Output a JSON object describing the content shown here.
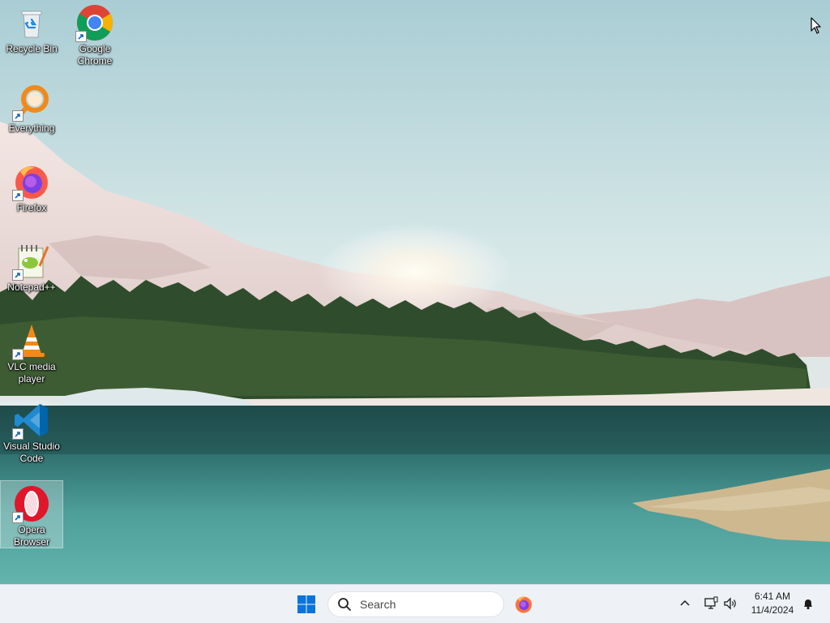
{
  "desktop": {
    "icons": [
      {
        "name": "recycle-bin",
        "label": "Recycle Bin",
        "icon": "recycle-bin-icon",
        "shortcut": false
      },
      {
        "name": "google-chrome",
        "label": "Google Chrome",
        "icon": "chrome-icon",
        "shortcut": true
      },
      {
        "name": "everything",
        "label": "Everything",
        "icon": "everything-search-icon",
        "shortcut": true
      },
      {
        "name": "firefox",
        "label": "Firefox",
        "icon": "firefox-icon",
        "shortcut": true
      },
      {
        "name": "notepad-plus-plus",
        "label": "Notepad++",
        "icon": "notepad-plus-plus-icon",
        "shortcut": true
      },
      {
        "name": "vlc-media-player",
        "label": "VLC media player",
        "icon": "vlc-cone-icon",
        "shortcut": true
      },
      {
        "name": "visual-studio-code",
        "label": "Visual Studio Code",
        "icon": "vscode-icon",
        "shortcut": true
      },
      {
        "name": "opera-browser",
        "label": "Opera Browser",
        "icon": "opera-icon",
        "shortcut": true,
        "selected": true
      }
    ]
  },
  "taskbar": {
    "search_placeholder": "Search",
    "start_icon": "windows-logo-icon",
    "pinned": [
      {
        "name": "firefox",
        "icon": "firefox-icon"
      }
    ],
    "tray_icons": [
      "chevron-up-icon",
      "network-icon",
      "speaker-icon",
      "notification-bell-icon"
    ]
  },
  "clock": {
    "time": "6:41 AM",
    "date": "11/4/2024"
  },
  "colors": {
    "taskbar_bg": "#eef2f6",
    "accent_blue": "#0067c0",
    "lake": "#3f8f90",
    "sky": "#cfe3e6"
  }
}
